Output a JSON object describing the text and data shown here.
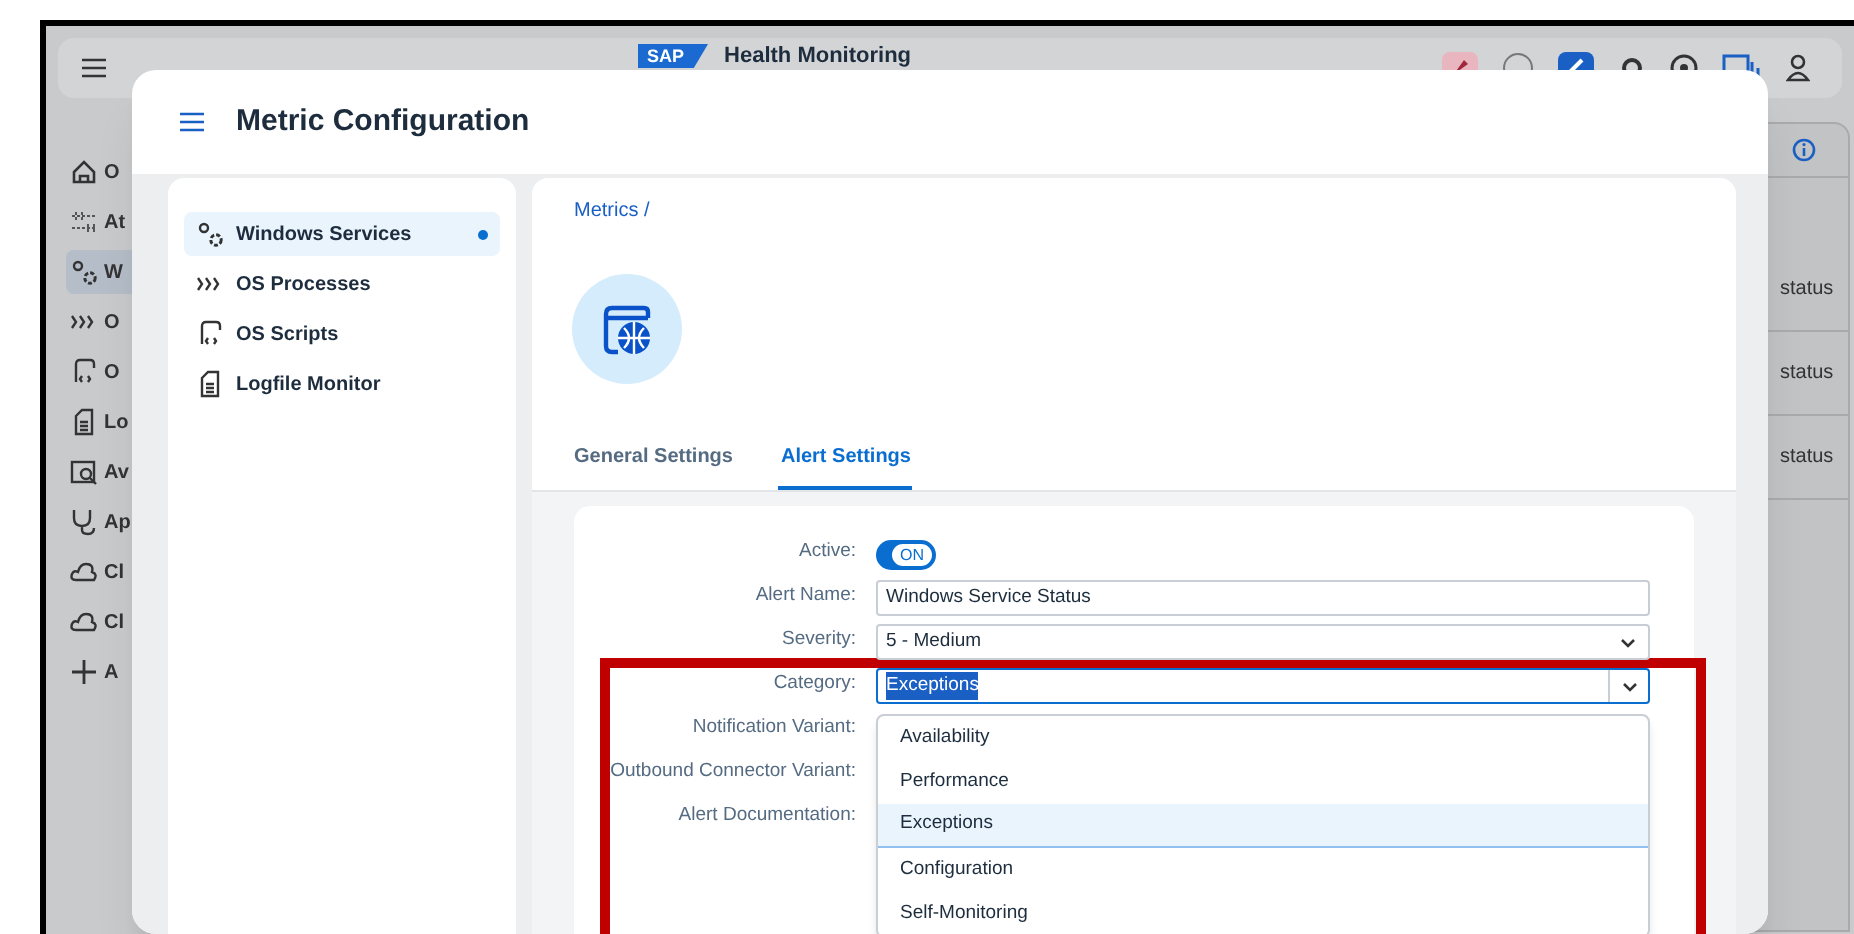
{
  "app": {
    "title": "Health Monitoring",
    "logo": "SAP",
    "nav": [
      {
        "label": "O",
        "selected": false
      },
      {
        "label": "At",
        "selected": false
      },
      {
        "label": "W",
        "selected": true
      },
      {
        "label": "O",
        "selected": false
      },
      {
        "label": "O",
        "selected": false
      },
      {
        "label": "Lo",
        "selected": false
      },
      {
        "label": "Av",
        "selected": false
      },
      {
        "label": "Ap",
        "selected": false
      },
      {
        "label": "Cl",
        "selected": false
      },
      {
        "label": "Cl",
        "selected": false
      },
      {
        "label": "A",
        "selected": false
      }
    ],
    "table_cells": [
      "status",
      "status",
      "status"
    ]
  },
  "dialog": {
    "title": "Metric Configuration",
    "metrics": [
      {
        "label": "Windows Services",
        "selected": true
      },
      {
        "label": "OS Processes",
        "selected": false
      },
      {
        "label": "OS Scripts",
        "selected": false
      },
      {
        "label": "Logfile Monitor",
        "selected": false
      }
    ],
    "breadcrumb": "Metrics /",
    "tabs": [
      {
        "label": "General Settings",
        "selected": false
      },
      {
        "label": "Alert Settings",
        "selected": true
      }
    ],
    "form": [
      {
        "label": "Active:",
        "kind": "switch",
        "on": true,
        "value": "ON"
      },
      {
        "label": "Alert Name:",
        "kind": "input",
        "value": "Windows Service Status"
      },
      {
        "label": "Severity:",
        "kind": "select",
        "value": "5 - Medium"
      },
      {
        "label": "Category:",
        "kind": "select",
        "value": "Exceptions",
        "focused": true
      },
      {
        "label": "Notification Variant:",
        "kind": "empty"
      },
      {
        "label": "Outbound Connector Variant:",
        "kind": "empty"
      },
      {
        "label": "Alert Documentation:",
        "kind": "empty"
      }
    ],
    "dropdown": [
      {
        "label": "Availability",
        "selected": false
      },
      {
        "label": "Performance",
        "selected": false
      },
      {
        "label": "Exceptions",
        "selected": true
      },
      {
        "label": "Configuration",
        "selected": false
      },
      {
        "label": "Self-Monitoring",
        "selected": false
      }
    ]
  }
}
